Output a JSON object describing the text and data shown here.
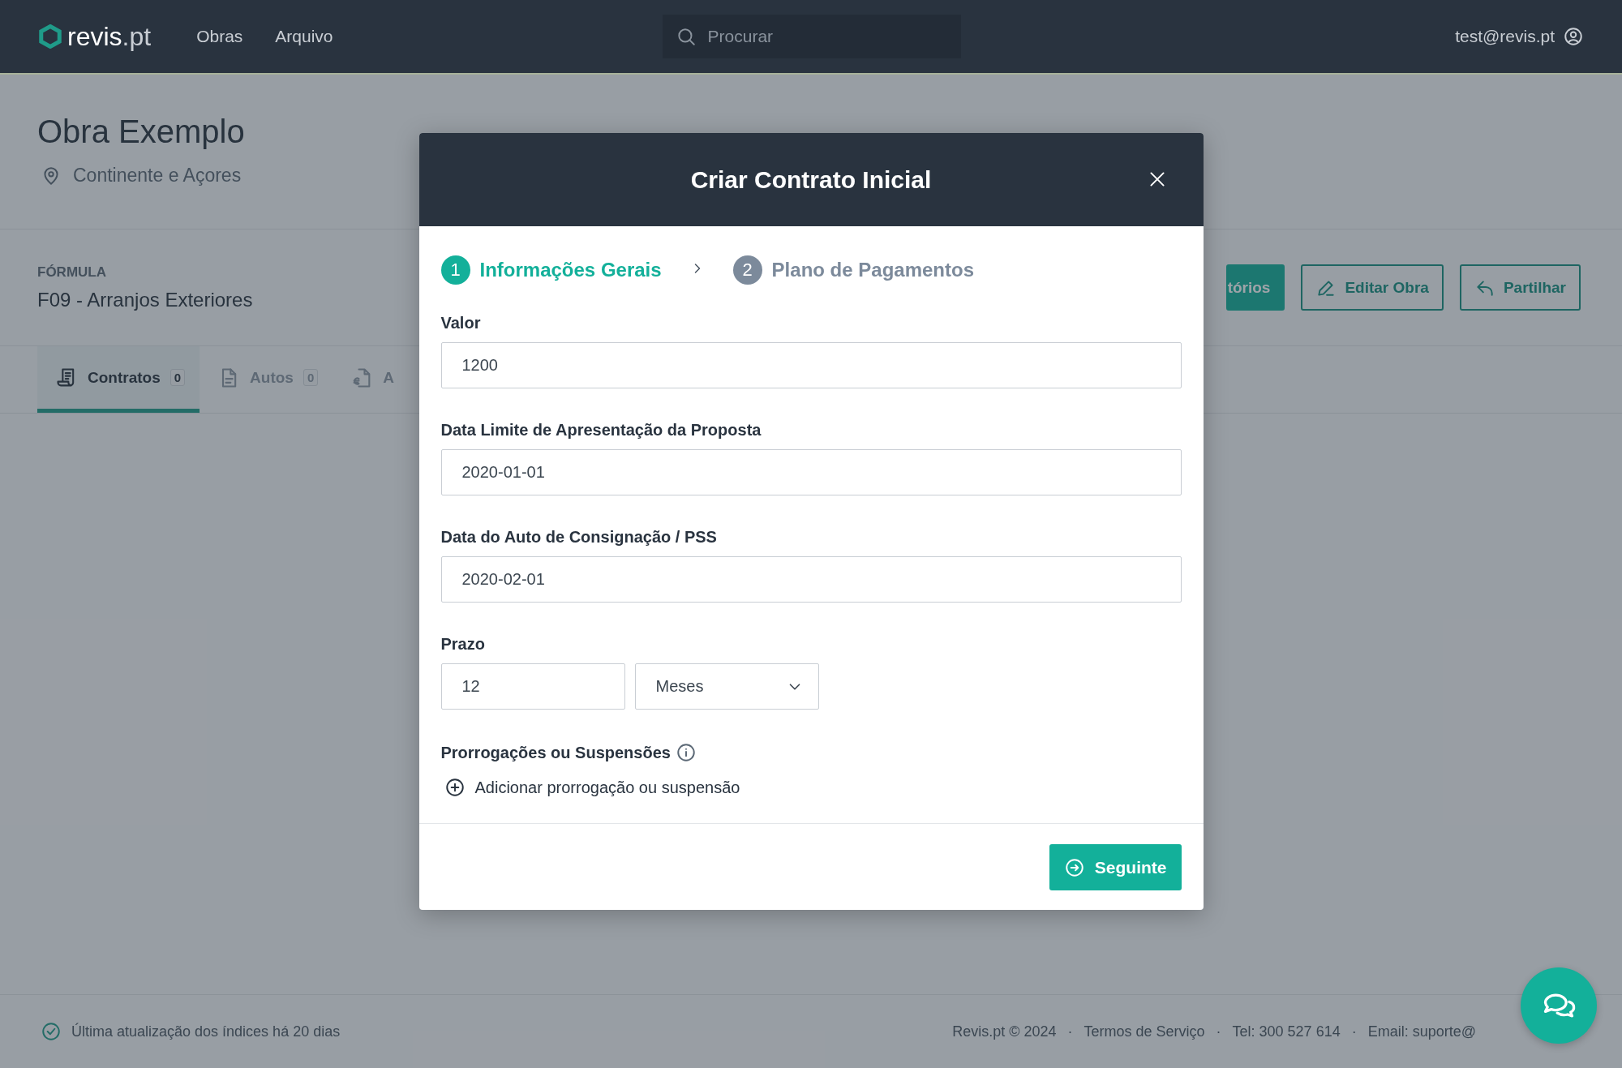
{
  "header": {
    "logo": "revis",
    "logo_suffix": ".pt",
    "nav": [
      {
        "label": "Obras"
      },
      {
        "label": "Arquivo"
      }
    ],
    "search": {
      "placeholder": "Procurar"
    },
    "user": "test@revis.pt"
  },
  "project": {
    "title": "Obra Exemplo",
    "location": "Continente e Açores",
    "formula_label": "FÓRMULA",
    "formula": "F09 - Arranjos Exteriores",
    "actions": [
      {
        "label": "tórios",
        "kind": "primary"
      },
      {
        "label": "Editar Obra",
        "kind": "outline"
      },
      {
        "label": "Partilhar",
        "kind": "outline"
      }
    ]
  },
  "tabs": [
    {
      "label": "Contratos",
      "count": "0",
      "selected": true
    },
    {
      "label": "Autos",
      "count": "0",
      "selected": false
    },
    {
      "label": "A",
      "selected": false
    }
  ],
  "modal": {
    "title": "Criar Contrato Inicial",
    "steps": [
      {
        "number": "1",
        "label": "Informações Gerais",
        "selected": true
      },
      {
        "number": "2",
        "label": "Plano de Pagamentos",
        "selected": false
      }
    ],
    "fields": [
      {
        "label": "Valor",
        "value": "1200"
      },
      {
        "label": "Data Limite de Apresentação da Proposta",
        "value": "2020-01-01"
      },
      {
        "label": "Data do Auto de Consignação / PSS",
        "value": "2020-02-01"
      }
    ],
    "prazo": {
      "label": "Prazo",
      "value": "12",
      "unit": "Meses"
    },
    "extensions": {
      "label": "Prorrogações ou Suspensões",
      "add": "Adicionar prorrogação ou suspensão"
    },
    "next": "Seguinte"
  },
  "footer": {
    "status": "Última atualização dos índices há 20 dias",
    "items": [
      {
        "text": "Revis.pt © 2024"
      },
      {
        "separator": "·",
        "text": "Termos de Serviço"
      },
      {
        "separator": "·",
        "text": "Tel: 300 527 614"
      },
      {
        "separator": "·",
        "text": "Email: suporte@"
      }
    ]
  }
}
